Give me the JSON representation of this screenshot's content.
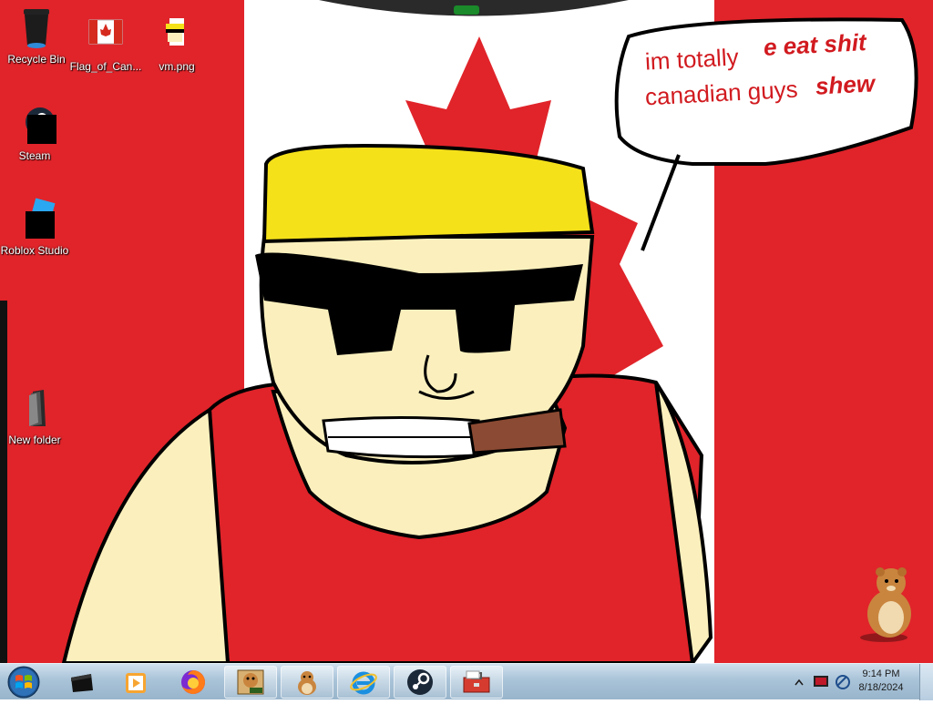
{
  "desktop_icons": [
    {
      "label": "Recycle Bin",
      "icon": "recycle-bin-icon"
    },
    {
      "label": "Flag_of_Can...",
      "icon": "canada-flag-file-icon"
    },
    {
      "label": "vm.png",
      "icon": "image-file-icon"
    },
    {
      "label": "Steam",
      "icon": "steam-icon"
    },
    {
      "label": "Roblox Studio",
      "icon": "roblox-studio-icon"
    },
    {
      "label": "New folder",
      "icon": "folder-icon"
    }
  ],
  "wallpaper": {
    "speech_bubble": {
      "line1": "im totally",
      "line2": "canadian guys",
      "overlay_line1": "e eat shit",
      "overlay_line2": "shew"
    },
    "colors": {
      "red": "#e0242a",
      "white": "#ffffff",
      "skin": "#fbf0bd",
      "hair": "#f5e11a",
      "cigar": "#8b4a33"
    }
  },
  "taskbar": {
    "start_icon": "windows-start-orb-icon",
    "buttons": [
      {
        "icon": "media-center-icon",
        "pinned": false
      },
      {
        "icon": "media-player-icon",
        "pinned": false
      },
      {
        "icon": "firefox-icon",
        "pinned": false
      },
      {
        "icon": "hamster-box-icon",
        "pinned": true
      },
      {
        "icon": "hamster-icon",
        "pinned": true
      },
      {
        "icon": "internet-explorer-icon",
        "pinned": true
      },
      {
        "icon": "steam-icon",
        "pinned": true
      },
      {
        "icon": "toolbox-icon",
        "pinned": true
      }
    ],
    "tray": {
      "time": "9:14 PM",
      "date": "8/18/2024",
      "icons": [
        "show-hidden-icons-chevron",
        "display-icon",
        "network-icon"
      ]
    }
  }
}
